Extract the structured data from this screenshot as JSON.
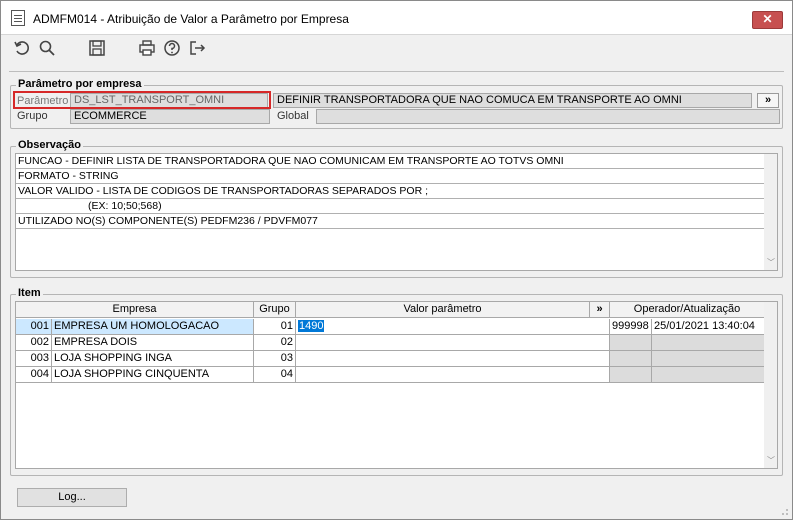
{
  "window": {
    "title": "ADMFM014 - Atribuição de Valor a Parâmetro por Empresa",
    "close_label": "✕"
  },
  "toolbar": {
    "icons": [
      "undo-icon",
      "search-icon",
      "save-icon",
      "print-icon",
      "help-icon",
      "exit-icon"
    ]
  },
  "parametro_group": {
    "title": "Parâmetro por empresa",
    "parametro_label": "Parâmetro",
    "parametro_value": "DS_LST_TRANSPORT_OMNI",
    "description_value": "DEFINIR TRANSPORTADORA QUE NAO COMUCA EM TRANSPORTE AO OMNI",
    "more_label": "»",
    "grupo_label": "Grupo",
    "grupo_value": "ECOMMERCE",
    "global_label": "Global",
    "global_value": ""
  },
  "observacao": {
    "title": "Observação",
    "lines": [
      "FUNCAO - DEFINIR LISTA DE TRANSPORTADORA QUE NAO COMUNICAM EM TRANSPORTE AO TOTVS OMNI",
      "FORMATO - STRING",
      "VALOR VALIDO - LISTA DE CODIGOS DE TRANSPORTADORAS SEPARADOS POR ;",
      "                        (EX: 10;50;568)",
      "UTILIZADO NO(S) COMPONENTE(S) PEDFM236 / PDVFM077"
    ]
  },
  "item": {
    "title": "Item",
    "headers": {
      "empresa": "Empresa",
      "grupo": "Grupo",
      "valor": "Valor parâmetro",
      "more": "»",
      "operador": "Operador/Atualização"
    },
    "rows": [
      {
        "code": "001",
        "name": "EMPRESA UM HOMOLOGACAO",
        "grupo": "01",
        "valor": "1490",
        "operador": "999998",
        "atualizacao": "25/01/2021 13:40:04",
        "selected": true
      },
      {
        "code": "002",
        "name": "EMPRESA DOIS",
        "grupo": "02",
        "valor": "",
        "operador": "",
        "atualizacao": "",
        "selected": false
      },
      {
        "code": "003",
        "name": "LOJA SHOPPING INGA",
        "grupo": "03",
        "valor": "",
        "operador": "",
        "atualizacao": "",
        "selected": false
      },
      {
        "code": "004",
        "name": "LOJA SHOPPING CINQUENTA",
        "grupo": "04",
        "valor": "",
        "operador": "",
        "atualizacao": "",
        "selected": false
      }
    ]
  },
  "footer": {
    "log_label": "Log..."
  }
}
